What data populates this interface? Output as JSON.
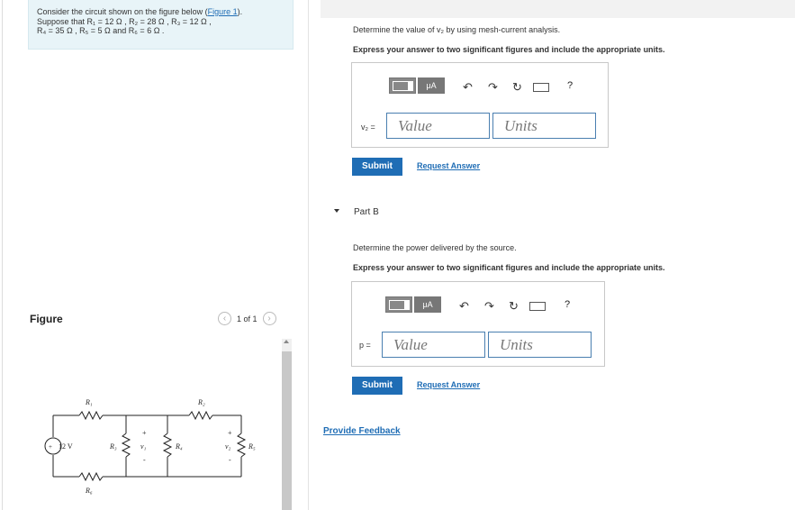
{
  "problem": {
    "intro": "Consider the circuit shown on the figure below (",
    "figure_link": "Figure 1",
    "intro_end": ").",
    "line2": "Suppose that R₁ = 12 Ω , R₂ = 28 Ω , R₃ = 12 Ω ,",
    "line3": "R₄ = 35 Ω , R₅ = 5 Ω and R₆ = 6 Ω ."
  },
  "part_a": {
    "instruction": "Determine the value of v₂ by using mesh-current analysis.",
    "format": "Express your answer to two significant figures and include the appropriate units.",
    "var_label": "v₂ =",
    "value_placeholder": "Value",
    "units_placeholder": "Units",
    "submit_label": "Submit",
    "request_answer_label": "Request Answer"
  },
  "part_b": {
    "title": "Part B",
    "instruction": "Determine the power delivered by the source.",
    "format": "Express your answer to two significant figures and include the appropriate units.",
    "var_label": "p =",
    "value_placeholder": "Value",
    "units_placeholder": "Units",
    "submit_label": "Submit",
    "request_answer_label": "Request Answer"
  },
  "toolbar": {
    "units_button_label": "μA",
    "help_label": "?"
  },
  "figure": {
    "title": "Figure",
    "pager": "1 of 1",
    "labels": {
      "r1": "R₁",
      "r2": "R₂",
      "r3": "R₃",
      "r4": "R₄",
      "r5": "R₅",
      "r6": "R₆",
      "source": "12 V",
      "v1": "v₁",
      "v2": "v₂",
      "plus": "+",
      "minus": "-"
    }
  },
  "feedback_label": "Provide Feedback"
}
